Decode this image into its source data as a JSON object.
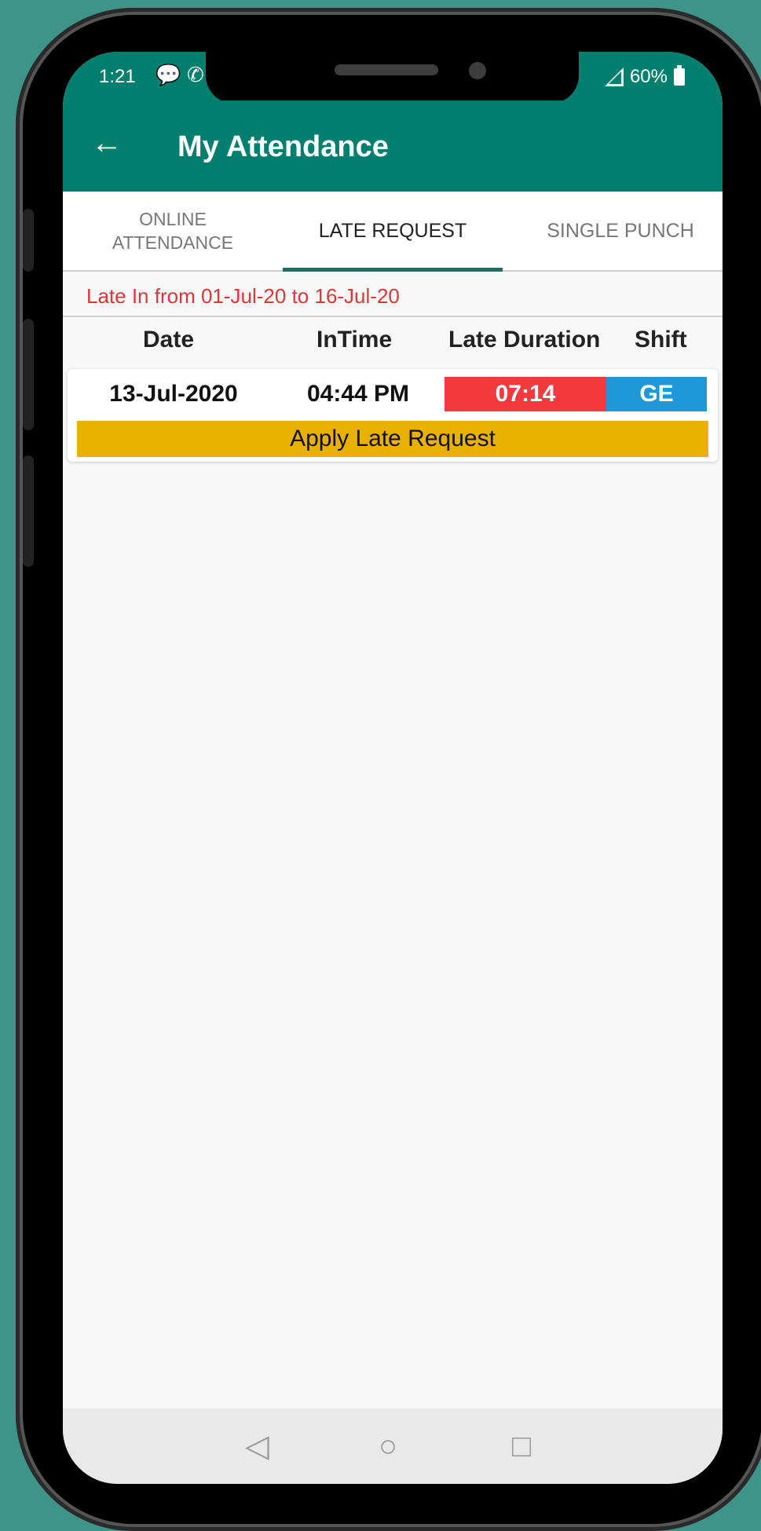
{
  "status_bar": {
    "time": "1:21",
    "icons": [
      "message-icon",
      "whatsapp-icon"
    ],
    "battery": "60%"
  },
  "app_bar": {
    "back_icon": "arrow-left-icon",
    "title": "My Attendance"
  },
  "tabs": [
    {
      "label": "ONLINE\nATTENDANCE",
      "active": false
    },
    {
      "label": "LATE REQUEST",
      "active": true
    },
    {
      "label": "SINGLE PUNCH",
      "active": false
    }
  ],
  "range_text": "Late In from 01-Jul-20 to 16-Jul-20",
  "table": {
    "headers": [
      "Date",
      "InTime",
      "Late Duration",
      "Shift"
    ],
    "rows": [
      {
        "date": "13-Jul-2020",
        "in_time": "04:44 PM",
        "late_duration": "07:14",
        "shift": "GE"
      }
    ],
    "apply_label": "Apply Late Request"
  },
  "colors": {
    "primary": "#007f6f",
    "late": "#f23a3f",
    "shift": "#1d99d7",
    "apply": "#e8b100",
    "range_text": "#e0353a"
  },
  "nav_bar": {
    "icons": [
      "back-triangle-icon",
      "home-circle-icon",
      "recents-square-icon"
    ]
  }
}
